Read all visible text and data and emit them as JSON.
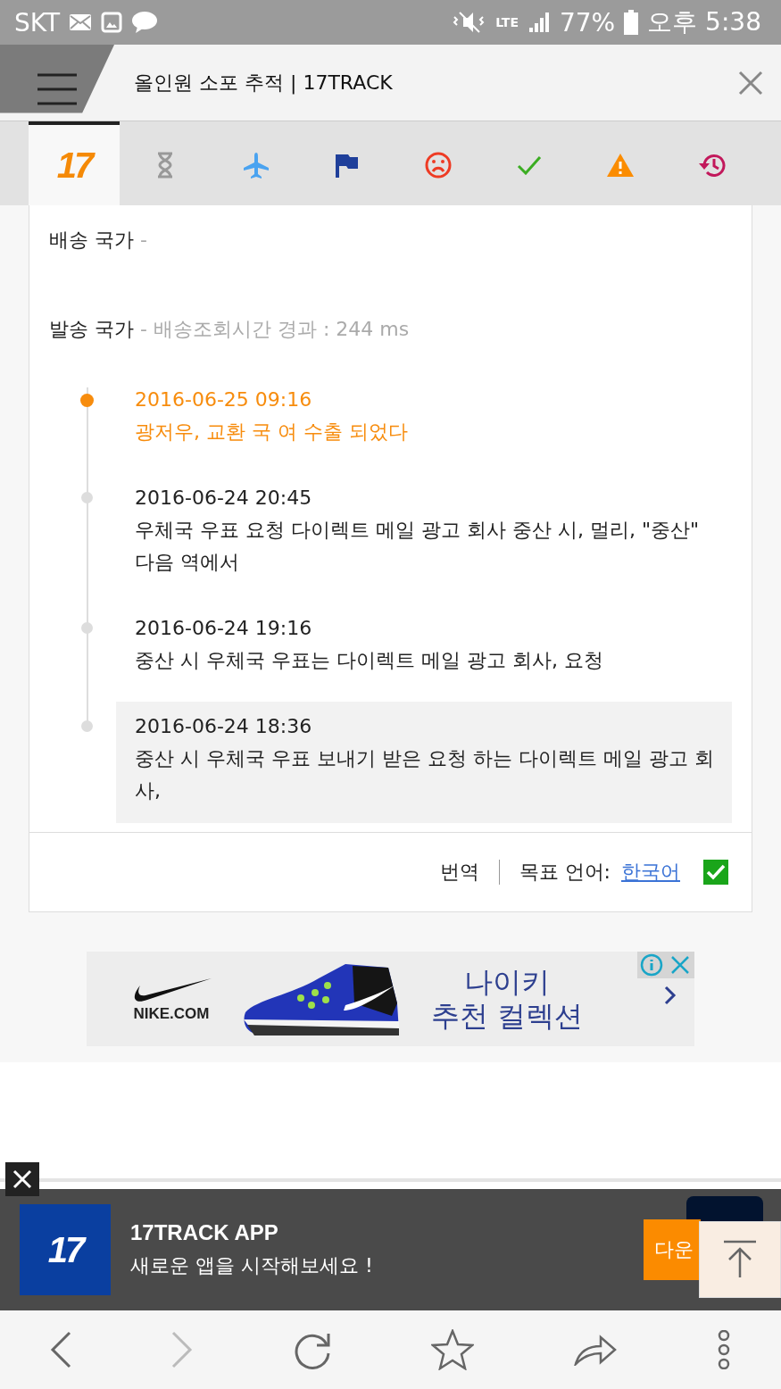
{
  "status_bar": {
    "carrier": "SKT",
    "network": "LTE",
    "battery": "77%",
    "time": "오후 5:38"
  },
  "browser_tab": {
    "title": "올인원 소포 추적 | 17TRACK"
  },
  "filter_tabs": [
    {
      "kind": "logo",
      "label": "17",
      "selected": true
    },
    {
      "kind": "pending",
      "selected": false
    },
    {
      "kind": "transit",
      "selected": false
    },
    {
      "kind": "pickup",
      "selected": false
    },
    {
      "kind": "undelivered",
      "selected": false
    },
    {
      "kind": "delivered",
      "selected": false
    },
    {
      "kind": "alert",
      "selected": false
    },
    {
      "kind": "expired",
      "selected": false
    }
  ],
  "destination": {
    "label": "배송 국가",
    "value": "-"
  },
  "origin": {
    "label": "발송 국가",
    "value": "- 배송조회시간 경과 : 244 ms"
  },
  "events": [
    {
      "time": "2016-06-25 09:16",
      "text": "광저우, 교환 국 여 수출 되었다",
      "latest": true,
      "highlighted": false
    },
    {
      "time": "2016-06-24 20:45",
      "text": "우체국 우표 요청 다이렉트 메일 광고 회사 중산 시, 멀리, \"중산\" 다음 역에서",
      "latest": false,
      "highlighted": false
    },
    {
      "time": "2016-06-24 19:16",
      "text": "중산 시 우체국 우표는 다이렉트 메일 광고 회사, 요청",
      "latest": false,
      "highlighted": false
    },
    {
      "time": "2016-06-24 18:36",
      "text": "중산 시 우체국 우표 보내기 받은 요청 하는 다이렉트 메일 광고 회사,",
      "latest": false,
      "highlighted": true
    }
  ],
  "translate": {
    "label": "번역",
    "target_label": "목표 언어:",
    "language": "한국어",
    "checked": true
  },
  "ad": {
    "brand": "NIKE.COM",
    "headline": "나이키",
    "subline": "추천 컬렉션"
  },
  "app_banner": {
    "logo": "17",
    "title": "17TRACK APP",
    "subtitle": "새로운 앱을 시작해보세요 !",
    "button": "다운"
  }
}
